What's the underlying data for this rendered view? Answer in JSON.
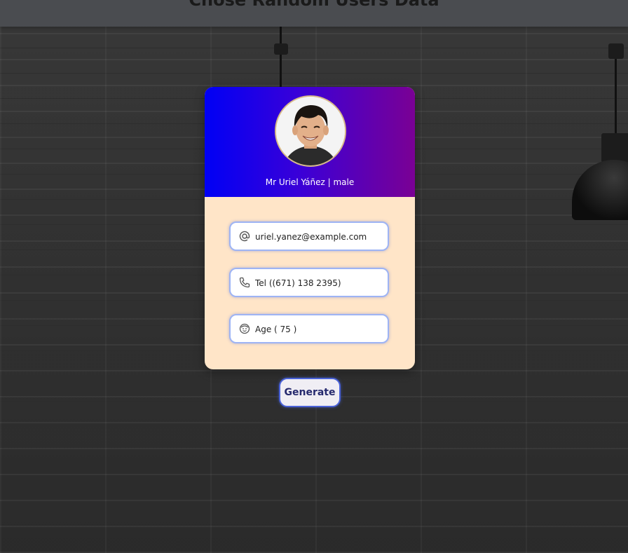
{
  "page": {
    "title": "Chose Random Users Data"
  },
  "card": {
    "user_name": "Mr Uriel Yáñez | male",
    "email": "uriel.yanez@example.com",
    "phone": "Tel ((671) 138 2395)",
    "age": "Age ( 75 )"
  },
  "actions": {
    "generate_label": "Generate"
  },
  "icons": {
    "email": "at-sign-icon",
    "phone": "phone-icon",
    "age": "face-icon"
  },
  "colors": {
    "header_gradient_start": "#0000f5",
    "header_gradient_end": "#7a0094",
    "card_body": "#ffe5c8",
    "field_border": "#9eb4f4",
    "button_border": "#4a62d8",
    "button_text": "#262a6e"
  }
}
